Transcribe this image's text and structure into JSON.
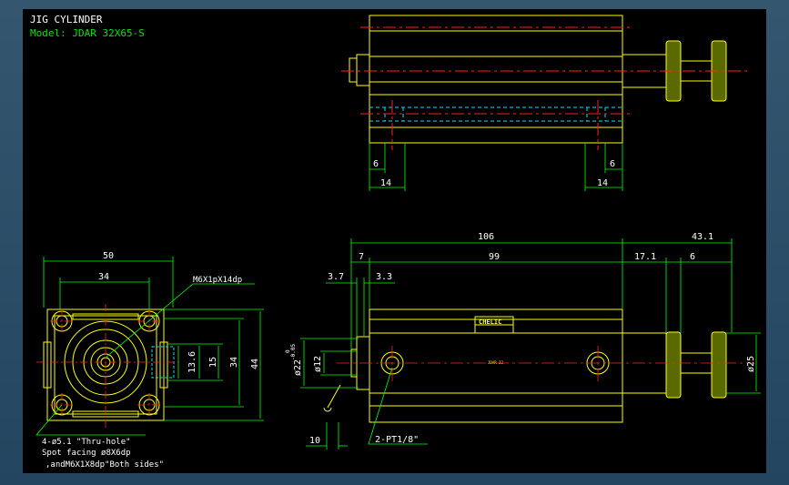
{
  "drawing": {
    "title": "JIG CYLINDER",
    "model": "Model: JDAR 32X65-S"
  },
  "colors": {
    "background": "#000000",
    "outline": "#ffff00",
    "dimension": "#00ff00",
    "centerline": "#ff2020",
    "hidden": "#00e0ff",
    "label": "#ffffff"
  },
  "top_view": {
    "dims": {
      "d6_left": "6",
      "d14_left": "14",
      "d6_right": "6",
      "d14_right": "14"
    }
  },
  "front_view": {
    "dims": {
      "d50": "50",
      "d34_top": "34",
      "d13_6": "13.6",
      "d15": "15",
      "d34_side": "34",
      "d44": "44"
    },
    "notes": {
      "thread": "M6X1pX14dp",
      "holes": "4-ø5.1 \"Thru-hole\"",
      "spot": "Spot facing ø8X6dp",
      "sides": ",andM6X1X8dp\"Both sides\""
    }
  },
  "side_view": {
    "dims": {
      "d106": "106",
      "d43_1": "43.1",
      "d7": "7",
      "d99": "99",
      "d17_1": "17.1",
      "d6": "6",
      "d3_7": "3.7",
      "d3_3": "3.3",
      "d22": "ø22",
      "d22_tol_upper": "0",
      "d22_tol_lower": "-0.05",
      "d12": "ø12",
      "d25": "ø25",
      "d10": "10"
    },
    "port_note": "2-PT1/8\"",
    "brand_label": "CHELIC",
    "model_mark": "JDAR 32"
  }
}
